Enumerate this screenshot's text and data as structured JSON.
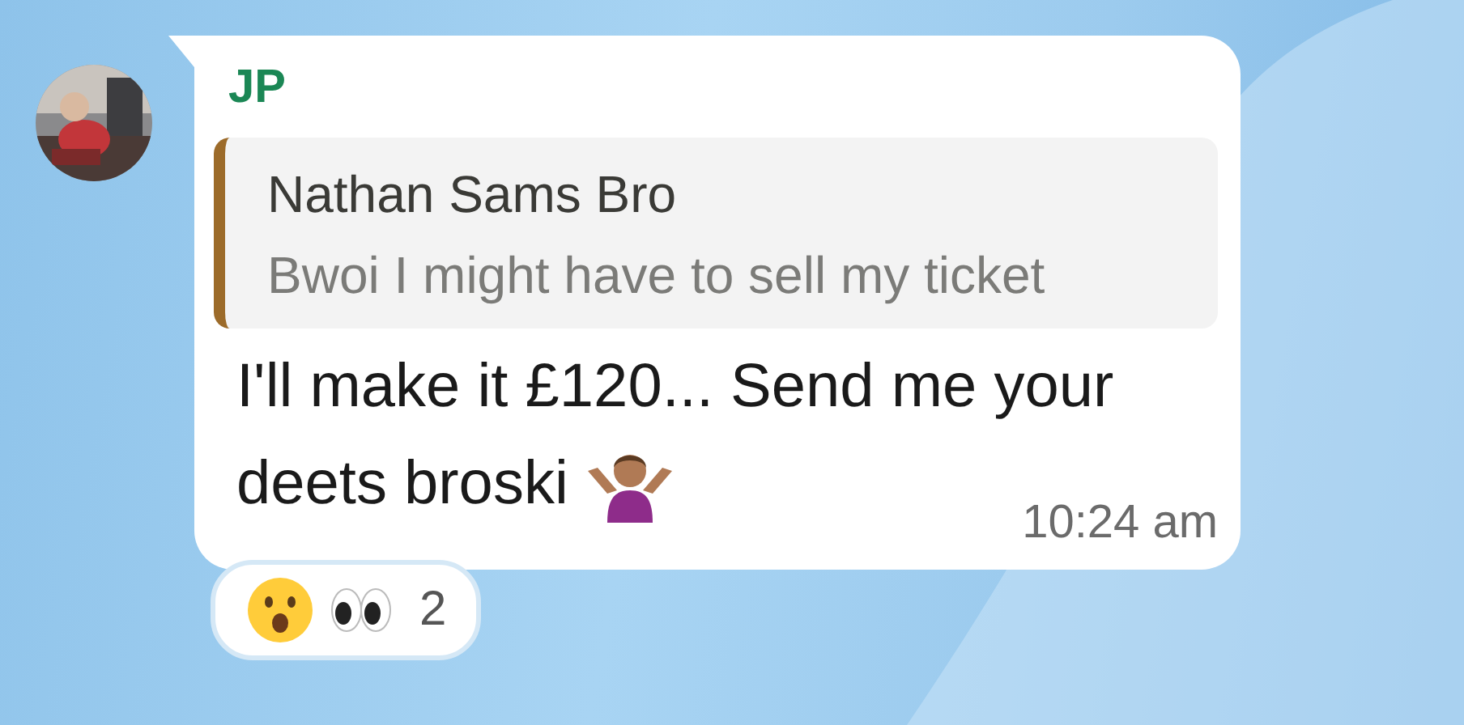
{
  "sender": {
    "name": "JP"
  },
  "quote": {
    "author": "Nathan Sams Bro",
    "text": "Bwoi I might have to sell my ticket"
  },
  "message": {
    "lines": [
      "I'll make it £120... Send me your",
      "deets broski"
    ],
    "time": "10:24 am"
  },
  "reactions": {
    "count": "2"
  }
}
